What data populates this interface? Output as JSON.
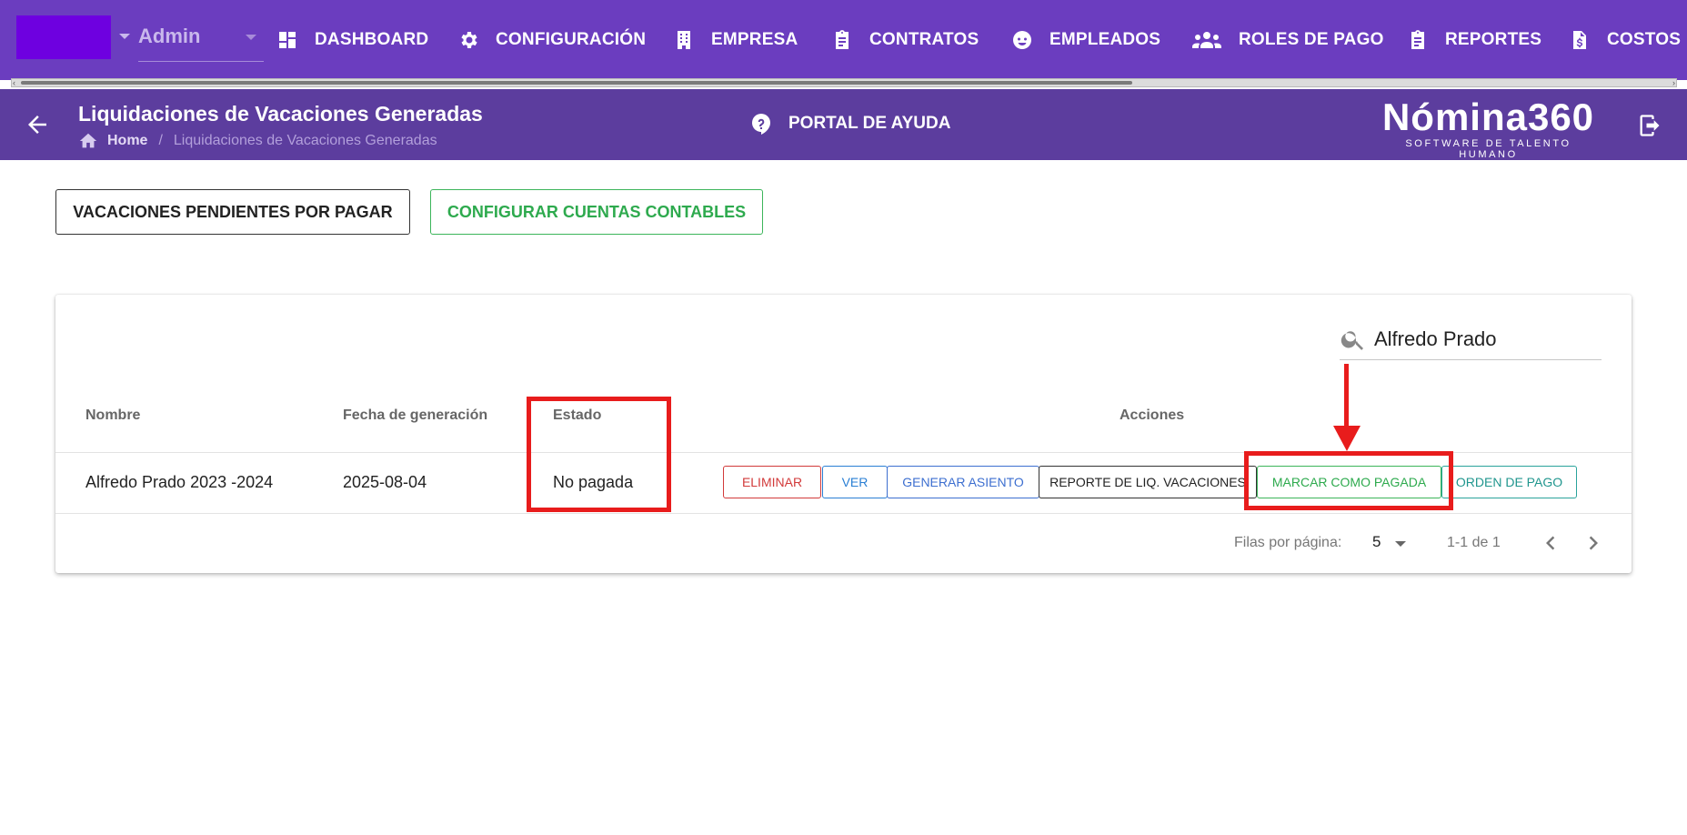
{
  "company_select": {
    "value": "Admin"
  },
  "nav": [
    {
      "label": "DASHBOARD",
      "icon": "dashboard-icon"
    },
    {
      "label": "CONFIGURACIÓN",
      "icon": "gear-icon"
    },
    {
      "label": "EMPRESA",
      "icon": "building-icon"
    },
    {
      "label": "CONTRATOS",
      "icon": "clipboard-icon"
    },
    {
      "label": "EMPLEADOS",
      "icon": "face-icon"
    },
    {
      "label": "ROLES DE PAGO",
      "icon": "group-icon"
    },
    {
      "label": "REPORTES",
      "icon": "clipboard-icon"
    },
    {
      "label": "COSTOS",
      "icon": "dollar-document-icon"
    }
  ],
  "header": {
    "title": "Liquidaciones de Vacaciones Generadas",
    "breadcrumb_home": "Home",
    "breadcrumb_separator": "/",
    "breadcrumb_current": "Liquidaciones de Vacaciones Generadas",
    "help_label": "PORTAL DE AYUDA",
    "brand_name": "Nómina360",
    "brand_tagline": "SOFTWARE DE TALENTO HUMANO"
  },
  "toolbar": {
    "pending_label": "VACACIONES PENDIENTES POR PAGAR",
    "accounts_label": "CONFIGURAR CUENTAS CONTABLES"
  },
  "search": {
    "value": "Alfredo Prado"
  },
  "table": {
    "columns": [
      "Nombre",
      "Fecha de generación",
      "Estado",
      "Acciones"
    ],
    "rows": [
      {
        "nombre": "Alfredo Prado 2023 -2024",
        "fecha": "2025-08-04",
        "estado": "No pagada",
        "actions": [
          "ELIMINAR",
          "VER",
          "GENERAR ASIENTO",
          "REPORTE DE LIQ. VACACIONES",
          "MARCAR COMO PAGADA",
          "ORDEN DE PAGO"
        ]
      }
    ]
  },
  "pagination": {
    "rows_per_page_label": "Filas por página:",
    "rows_per_page": "5",
    "range": "1-1 de 1"
  },
  "colors": {
    "topbar": "#6b3dbf",
    "header": "#5c3d9e",
    "highlight": "#e81c1c",
    "success": "#2eaa4e",
    "danger": "#d23a3a"
  }
}
